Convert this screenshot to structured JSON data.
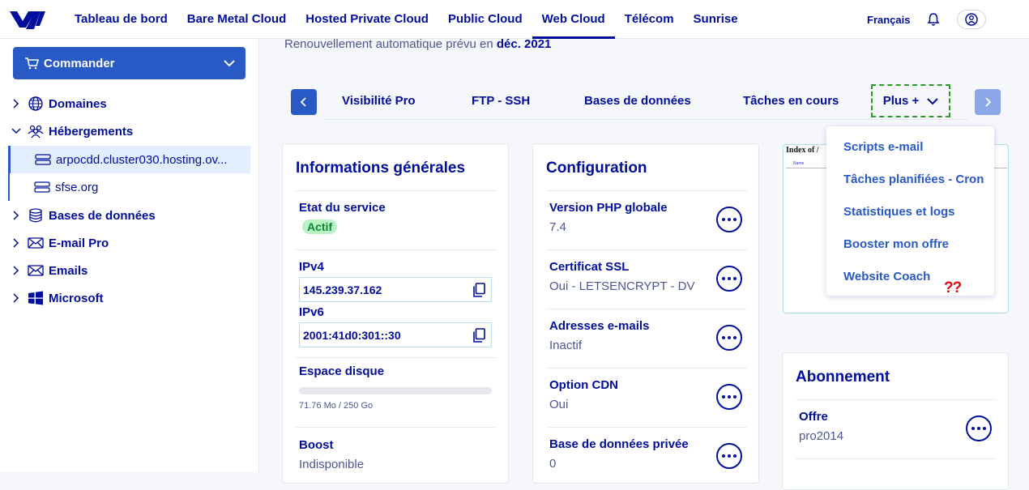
{
  "topnav": {
    "items": [
      "Tableau de bord",
      "Bare Metal Cloud",
      "Hosted Private Cloud",
      "Public Cloud",
      "Web Cloud",
      "Télécom",
      "Sunrise"
    ],
    "active": "Web Cloud",
    "language": "Français"
  },
  "sidebar": {
    "order_label": "Commander",
    "items": [
      {
        "label": "Domaines",
        "icon": "globe-icon",
        "expanded": false
      },
      {
        "label": "Hébergements",
        "icon": "people-icon",
        "expanded": true
      },
      {
        "label": "Bases de données",
        "icon": "database-icon",
        "expanded": false
      },
      {
        "label": "E-mail Pro",
        "icon": "envelope-icon",
        "expanded": false
      },
      {
        "label": "Emails",
        "icon": "envelope-icon",
        "expanded": false
      },
      {
        "label": "Microsoft",
        "icon": "windows-icon",
        "expanded": false
      }
    ],
    "hostings": [
      "arpocdd.cluster030.hosting.ov...",
      "sfse.org"
    ]
  },
  "renewal": {
    "prefix": "Renouvellement automatique prévu en",
    "date": "déc. 2021"
  },
  "tabs": [
    "Visibilité Pro",
    "FTP - SSH",
    "Bases de données",
    "Tâches en cours"
  ],
  "more_tab": "Plus +",
  "more_menu": [
    "Scripts e-mail",
    "Tâches planifiées - Cron",
    "Statistiques et logs",
    "Booster mon offre",
    "Website Coach"
  ],
  "annotation": "??",
  "general_info": {
    "title": "Informations générales",
    "service_state_label": "Etat du service",
    "service_state": "Actif",
    "ipv4_label": "IPv4",
    "ipv4": "145.239.37.162",
    "ipv6_label": "IPv6",
    "ipv6": "2001:41d0:301::30",
    "disk_label": "Espace disque",
    "disk_usage": "71.76 Mo / 250 Go",
    "disk_fraction": 0.0003,
    "boost_label": "Boost",
    "boost_value": "Indisponible"
  },
  "configuration": {
    "title": "Configuration",
    "rows": [
      {
        "label": "Version PHP globale",
        "value": "7.4"
      },
      {
        "label": "Certificat SSL",
        "value": "Oui - LETSENCRYPT - DV"
      },
      {
        "label": "Adresses e-mails",
        "value": "Inactif"
      },
      {
        "label": "Option CDN",
        "value": "Oui"
      },
      {
        "label": "Base de données privée",
        "value": "0"
      }
    ]
  },
  "preview": {
    "heading": "Index of /",
    "link": "Name"
  },
  "subscription": {
    "title": "Abonnement",
    "offer_label": "Offre",
    "offer_value": "pro2014"
  }
}
